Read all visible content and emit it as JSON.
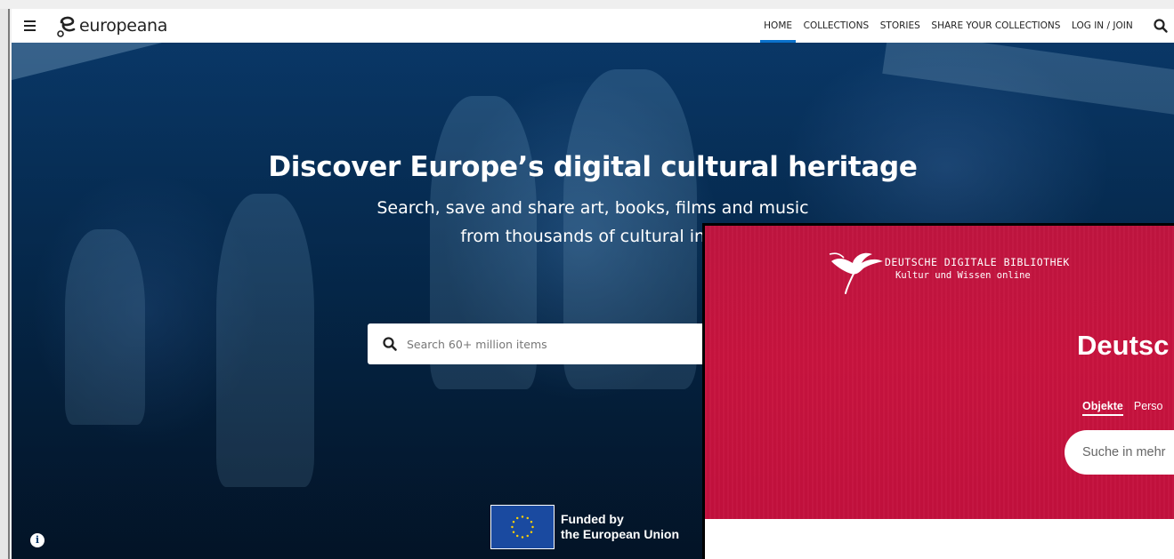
{
  "header": {
    "logo_text": "europeana",
    "nav": [
      "HOME",
      "COLLECTIONS",
      "STORIES",
      "SHARE YOUR COLLECTIONS",
      "LOG IN / JOIN"
    ],
    "active_nav": "HOME"
  },
  "hero": {
    "title": "Discover Europe’s digital cultural heritage",
    "subtitle_line1": "Search, save and share art, books, films and music",
    "subtitle_line2": "from thousands of cultural insti",
    "search_placeholder": "Search 60+ million items"
  },
  "funding": {
    "line1": "Funded by",
    "line2": "the European Union"
  },
  "overlay": {
    "brand_line1": "DEUTSCHE DIGITALE BIBLIOTHEK",
    "brand_line2": "Kultur und Wissen online",
    "title": "Deutsc",
    "tabs": [
      "Objekte",
      "Perso"
    ],
    "search_placeholder": "Suche in mehr"
  },
  "colors": {
    "accent": "#0a72cc",
    "hero_blue": "#06305a",
    "ddb_red": "#c8133e"
  }
}
